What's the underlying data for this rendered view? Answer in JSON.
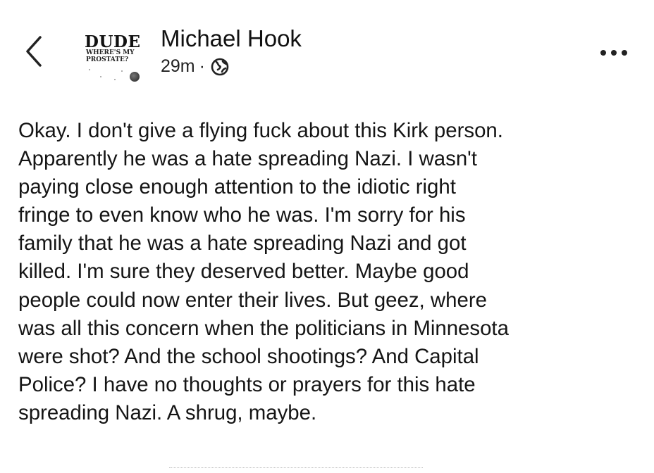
{
  "header": {
    "back_icon": "chevron-left-icon",
    "more_icon": "more-horizontal-icon"
  },
  "author": {
    "name": "Michael Hook",
    "avatar_text_large": "DUDE",
    "avatar_text_small": "WHERE'S MY PROSTATE?"
  },
  "meta": {
    "time": "29m",
    "separator": "·",
    "privacy_icon": "globe-icon"
  },
  "post": {
    "lines": [
      "Okay. I don't give a flying fuck about this Kirk person.",
      "Apparently he was a hate spreading Nazi. I wasn't",
      "paying close enough attention to the idiotic right",
      "fringe to even know who he was. I'm sorry for his",
      "family that he was a hate spreading Nazi and got",
      "killed. I'm sure they deserved better. Maybe good",
      "people could now enter their lives. But geez, where",
      "was all this concern when the politicians in Minnesota",
      "were shot?  And the school shootings? And Capital",
      "Police? I have no thoughts or prayers for this hate",
      "spreading Nazi. A shrug, maybe."
    ]
  },
  "colors": {
    "text": "#111111",
    "background": "#ffffff"
  }
}
